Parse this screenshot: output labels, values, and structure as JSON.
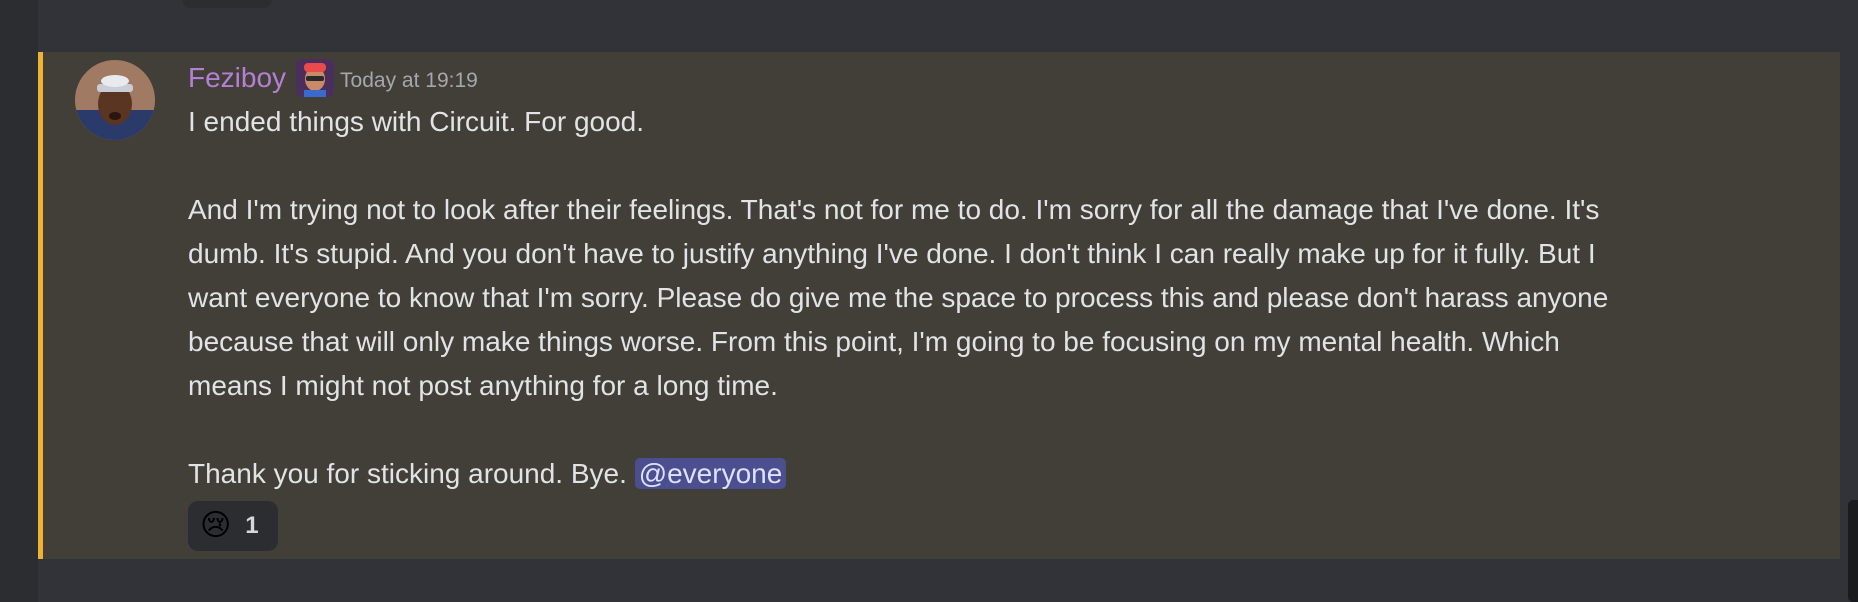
{
  "message": {
    "author": "Feziboy",
    "timestamp": "Today at 19:19",
    "lines": [
      "I ended things with Circuit. For good.",
      "",
      "And I'm trying not to look after their feelings. That's not for me to do. I'm sorry for all the damage that I've done. It's",
      "dumb. It's stupid. And you don't have to justify anything I've done. I don't think I can really make up for it fully. But I",
      "want everyone to know that I'm sorry. Please do give me the space to process this and please don't harass anyone",
      "because that will only make things worse. From this point, I'm going to be focusing on my mental health. Which",
      "means I might not post anything for a long time.",
      ""
    ],
    "last_line_text": "Thank you for sticking around. Bye. ",
    "mention": "@everyone",
    "reaction": {
      "emoji": "😢",
      "count": "1"
    }
  },
  "colors": {
    "username": "#b57fd6",
    "highlight_bar": "#f0b232",
    "message_bg": "#423f38",
    "page_bg": "#313338",
    "mention_bg": "#4b4f8f"
  }
}
